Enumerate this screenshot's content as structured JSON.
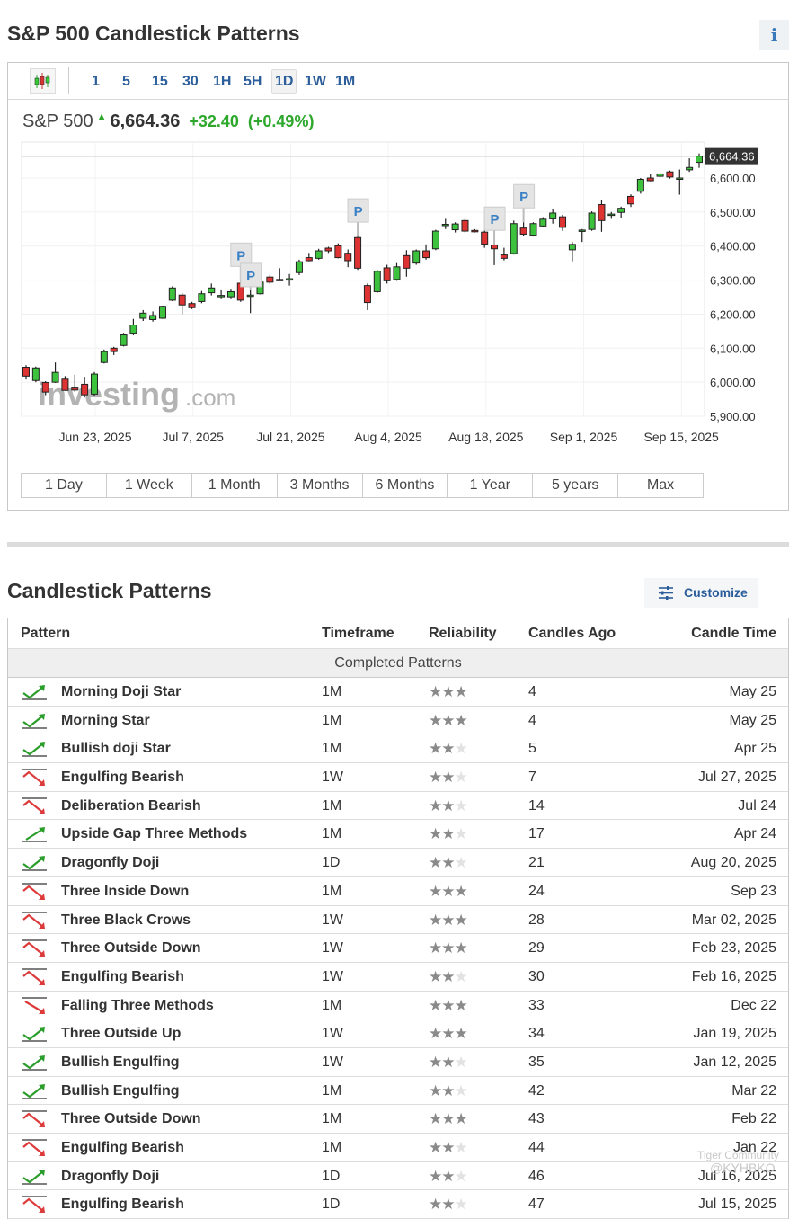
{
  "page": {
    "title": "S&P 500 Candlestick Patterns",
    "info_icon": "info-icon"
  },
  "toolbar": {
    "chart_type_icon": "candlestick-chart-icon",
    "timeframes": [
      "1",
      "5",
      "15",
      "30",
      "1H",
      "5H",
      "1D",
      "1W",
      "1M"
    ],
    "selected": "1D"
  },
  "quote": {
    "name": "S&P 500",
    "direction": "up",
    "price": "6,664.36",
    "change": "+32.40",
    "change_pct": "(+0.49%)",
    "color_up": "#2da82d"
  },
  "ranges": [
    "1 Day",
    "1 Week",
    "1 Month",
    "3 Months",
    "6 Months",
    "1 Year",
    "5 years",
    "Max"
  ],
  "watermark": "Investing.com",
  "chart_data": {
    "type": "candlestick",
    "last_price_label": "6,664.36",
    "ylim": [
      5900,
      6705
    ],
    "y_ticks": [
      "6,600.00",
      "6,500.00",
      "6,400.00",
      "6,300.00",
      "6,200.00",
      "6,100.00",
      "6,000.00",
      "5,900.00"
    ],
    "y_tick_values": [
      6600,
      6500,
      6400,
      6300,
      6200,
      6100,
      6000,
      5900
    ],
    "x_ticks": [
      "Jun 23, 2025",
      "Jul 7, 2025",
      "Jul 21, 2025",
      "Aug 4, 2025",
      "Aug 18, 2025",
      "Sep 1, 2025",
      "Sep 15, 2025"
    ],
    "grid": true,
    "colors": {
      "up": "#3cc23c",
      "down": "#dd3333"
    },
    "pattern_marker_label": "P",
    "pattern_marker_dates": [
      "Jul 15",
      "Jul 16",
      "Jul 31",
      "Aug 19",
      "Aug 22"
    ],
    "candles": [
      [
        "Jun 12",
        6044,
        6050,
        6008,
        6018
      ],
      [
        "Jun 13",
        6005,
        6046,
        6000,
        6042
      ],
      [
        "Jun 16",
        5999,
        6003,
        5962,
        5971
      ],
      [
        "Jun 17",
        6000,
        6058,
        5998,
        6029
      ],
      [
        "Jun 18",
        6009,
        6018,
        5975,
        5976
      ],
      [
        "Jun 20",
        5983,
        6022,
        5972,
        5977
      ],
      [
        "Jun 23",
        5994,
        6016,
        5955,
        5963
      ],
      [
        "Jun 24",
        5965,
        6030,
        5960,
        6024
      ],
      [
        "Jun 25",
        6058,
        6096,
        6055,
        6090
      ],
      [
        "Jun 26",
        6100,
        6104,
        6080,
        6090
      ],
      [
        "Jun 27",
        6108,
        6145,
        6105,
        6139
      ],
      [
        "Jun 30",
        6144,
        6186,
        6138,
        6168
      ],
      [
        "Jul 1",
        6188,
        6212,
        6180,
        6203
      ],
      [
        "Jul 2",
        6184,
        6208,
        6178,
        6196
      ],
      [
        "Jul 3",
        6188,
        6225,
        6186,
        6223
      ],
      [
        "Jul 7",
        6241,
        6282,
        6238,
        6277
      ],
      [
        "Jul 8",
        6256,
        6262,
        6200,
        6227
      ],
      [
        "Jul 9",
        6231,
        6236,
        6215,
        6219
      ],
      [
        "Jul 10",
        6237,
        6268,
        6232,
        6260
      ],
      [
        "Jul 11",
        6263,
        6290,
        6255,
        6277
      ],
      [
        "Jul 14",
        6254,
        6270,
        6244,
        6255
      ],
      [
        "Jul 15",
        6251,
        6272,
        6244,
        6266
      ],
      [
        "Jul 15",
        6291,
        6298,
        6236,
        6241
      ],
      [
        "Jul 16",
        6254,
        6270,
        6203,
        6256
      ],
      [
        "Jul 17",
        6260,
        6300,
        6258,
        6294
      ],
      [
        "Jul 18",
        6309,
        6315,
        6288,
        6294
      ],
      [
        "Jul 21",
        6301,
        6335,
        6298,
        6302
      ],
      [
        "Jul 22",
        6303,
        6318,
        6284,
        6304
      ],
      [
        "Jul 23",
        6322,
        6360,
        6315,
        6354
      ],
      [
        "Jul 24",
        6366,
        6380,
        6355,
        6357
      ],
      [
        "Jul 25",
        6364,
        6392,
        6360,
        6386
      ],
      [
        "Jul 28",
        6394,
        6398,
        6380,
        6386
      ],
      [
        "Jul 29",
        6401,
        6408,
        6364,
        6366
      ],
      [
        "Jul 30",
        6379,
        6390,
        6338,
        6357
      ],
      [
        "Jul 31",
        6425,
        6428,
        6330,
        6335
      ],
      [
        "Aug 1",
        6284,
        6290,
        6212,
        6234
      ],
      [
        "Aug 4",
        6266,
        6330,
        6262,
        6326
      ],
      [
        "Aug 5",
        6336,
        6345,
        6290,
        6298
      ],
      [
        "Aug 6",
        6302,
        6350,
        6298,
        6339
      ],
      [
        "Aug 7",
        6372,
        6388,
        6310,
        6335
      ],
      [
        "Aug 8",
        6350,
        6390,
        6345,
        6386
      ],
      [
        "Aug 11",
        6386,
        6405,
        6360,
        6366
      ],
      [
        "Aug 12",
        6392,
        6448,
        6388,
        6444
      ],
      [
        "Aug 13",
        6462,
        6480,
        6450,
        6464
      ],
      [
        "Aug 14",
        6448,
        6470,
        6440,
        6465
      ],
      [
        "Aug 15",
        6475,
        6480,
        6440,
        6444
      ],
      [
        "Aug 18",
        6446,
        6450,
        6440,
        6445
      ],
      [
        "Aug 19",
        6441,
        6450,
        6395,
        6406
      ],
      [
        "Aug 20",
        6403,
        6404,
        6344,
        6392
      ],
      [
        "Aug 21",
        6374,
        6395,
        6358,
        6364
      ],
      [
        "Aug 22",
        6378,
        6475,
        6375,
        6466
      ],
      [
        "Aug 25",
        6453,
        6470,
        6430,
        6435
      ],
      [
        "Aug 26",
        6432,
        6470,
        6428,
        6466
      ],
      [
        "Aug 27",
        6459,
        6485,
        6455,
        6479
      ],
      [
        "Aug 28",
        6480,
        6508,
        6466,
        6497
      ],
      [
        "Aug 29",
        6486,
        6492,
        6445,
        6455
      ],
      [
        "Sep 2",
        6389,
        6412,
        6355,
        6405
      ],
      [
        "Sep 3",
        6446,
        6450,
        6412,
        6447
      ],
      [
        "Sep 4",
        6449,
        6502,
        6445,
        6497
      ],
      [
        "Sep 5",
        6522,
        6535,
        6442,
        6475
      ],
      [
        "Sep 8",
        6492,
        6500,
        6480,
        6494
      ],
      [
        "Sep 9",
        6499,
        6516,
        6482,
        6511
      ],
      [
        "Sep 10",
        6546,
        6552,
        6515,
        6524
      ],
      [
        "Sep 11",
        6561,
        6600,
        6554,
        6596
      ],
      [
        "Sep 12",
        6600,
        6612,
        6590,
        6592
      ],
      [
        "Sep 15",
        6605,
        6615,
        6603,
        6612
      ],
      [
        "Sep 16",
        6618,
        6622,
        6598,
        6603
      ],
      [
        "Sep 17",
        6598,
        6625,
        6551,
        6600
      ],
      [
        "Sep 18",
        6624,
        6658,
        6618,
        6631
      ],
      [
        "Sep 19",
        6646,
        6672,
        6630,
        6664.36
      ]
    ]
  },
  "patterns": {
    "title": "Candlestick Patterns",
    "customize_label": "Customize",
    "customize_icon": "sliders-icon",
    "columns": [
      "Pattern",
      "Timeframe",
      "Reliability",
      "Candles Ago",
      "Candle Time"
    ],
    "section_label": "Completed Patterns",
    "rows": [
      {
        "icon": "bullish-reversal",
        "name": "Morning Doji Star",
        "timeframe": "1M",
        "stars": 3,
        "ago": "4",
        "time": "May 25"
      },
      {
        "icon": "bullish-reversal",
        "name": "Morning Star",
        "timeframe": "1M",
        "stars": 3,
        "ago": "4",
        "time": "May 25"
      },
      {
        "icon": "bullish-reversal",
        "name": "Bullish doji Star",
        "timeframe": "1M",
        "stars": 2,
        "ago": "5",
        "time": "Apr 25"
      },
      {
        "icon": "bearish-reversal",
        "name": "Engulfing Bearish",
        "timeframe": "1W",
        "stars": 2,
        "ago": "7",
        "time": "Jul 27, 2025"
      },
      {
        "icon": "bearish-reversal",
        "name": "Deliberation Bearish",
        "timeframe": "1M",
        "stars": 2,
        "ago": "14",
        "time": "Jul 24"
      },
      {
        "icon": "bullish-continuation",
        "name": "Upside Gap Three Methods",
        "timeframe": "1M",
        "stars": 2,
        "ago": "17",
        "time": "Apr 24"
      },
      {
        "icon": "bullish-reversal",
        "name": "Dragonfly Doji",
        "timeframe": "1D",
        "stars": 2,
        "ago": "21",
        "time": "Aug 20, 2025"
      },
      {
        "icon": "bearish-reversal",
        "name": "Three Inside Down",
        "timeframe": "1M",
        "stars": 3,
        "ago": "24",
        "time": "Sep 23"
      },
      {
        "icon": "bearish-reversal",
        "name": "Three Black Crows",
        "timeframe": "1W",
        "stars": 3,
        "ago": "28",
        "time": "Mar 02, 2025"
      },
      {
        "icon": "bearish-reversal",
        "name": "Three Outside Down",
        "timeframe": "1W",
        "stars": 3,
        "ago": "29",
        "time": "Feb 23, 2025"
      },
      {
        "icon": "bearish-reversal",
        "name": "Engulfing Bearish",
        "timeframe": "1W",
        "stars": 2,
        "ago": "30",
        "time": "Feb 16, 2025"
      },
      {
        "icon": "bearish-continuation",
        "name": "Falling Three Methods",
        "timeframe": "1M",
        "stars": 3,
        "ago": "33",
        "time": "Dec 22"
      },
      {
        "icon": "bullish-reversal",
        "name": "Three Outside Up",
        "timeframe": "1W",
        "stars": 3,
        "ago": "34",
        "time": "Jan 19, 2025"
      },
      {
        "icon": "bullish-reversal",
        "name": "Bullish Engulfing",
        "timeframe": "1W",
        "stars": 2,
        "ago": "35",
        "time": "Jan 12, 2025"
      },
      {
        "icon": "bullish-reversal",
        "name": "Bullish Engulfing",
        "timeframe": "1M",
        "stars": 2,
        "ago": "42",
        "time": "Mar 22"
      },
      {
        "icon": "bearish-reversal",
        "name": "Three Outside Down",
        "timeframe": "1M",
        "stars": 3,
        "ago": "43",
        "time": "Feb 22"
      },
      {
        "icon": "bearish-reversal",
        "name": "Engulfing Bearish",
        "timeframe": "1M",
        "stars": 2,
        "ago": "44",
        "time": "Jan 22"
      },
      {
        "icon": "bullish-reversal",
        "name": "Dragonfly Doji",
        "timeframe": "1D",
        "stars": 2,
        "ago": "46",
        "time": "Jul 16, 2025"
      },
      {
        "icon": "bearish-reversal",
        "name": "Engulfing Bearish",
        "timeframe": "1D",
        "stars": 2,
        "ago": "47",
        "time": "Jul 15, 2025"
      }
    ]
  },
  "overlay_watermark": {
    "line1": "Tiger Community",
    "line2": "@KYHBKO"
  }
}
